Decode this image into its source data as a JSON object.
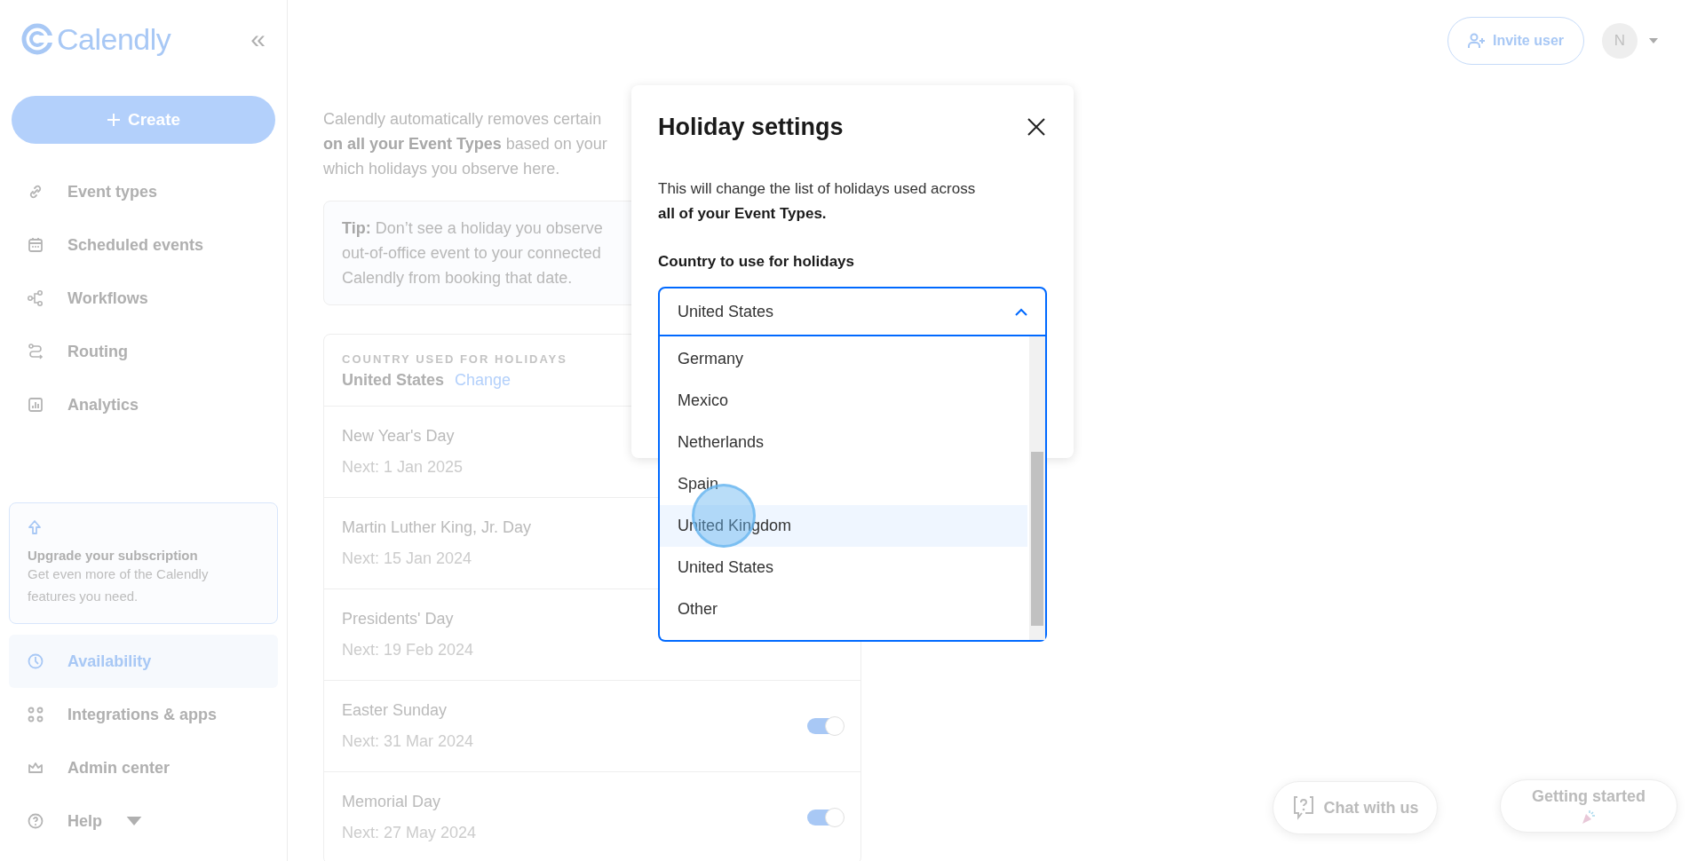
{
  "sidebar": {
    "logo": "Calendly",
    "collapse": "«",
    "create_button": "Create",
    "nav_top": [
      {
        "label": "Event types",
        "selected": false
      },
      {
        "label": "Scheduled events",
        "selected": false
      },
      {
        "label": "Workflows",
        "selected": false
      },
      {
        "label": "Routing",
        "selected": false
      },
      {
        "label": "Analytics",
        "selected": false
      }
    ],
    "upgrade": {
      "title": "Upgrade your subscription",
      "text": "Get even more of the Calendly features you need."
    },
    "nav_bottom": [
      {
        "label": "Availability",
        "selected": true
      },
      {
        "label": "Integrations & apps",
        "selected": false
      },
      {
        "label": "Admin center",
        "selected": false
      },
      {
        "label": "Help",
        "selected": false
      }
    ]
  },
  "header": {
    "invite_button": "Invite user",
    "avatar": "N"
  },
  "main": {
    "intro_lines": [
      "Calendly automatically removes certain",
      "**on all your Event Types** based on your",
      "which holidays you observe here."
    ],
    "tip_lines": [
      "**Tip:** Don’t see a holiday you observe",
      "out-of-office event to your connected",
      "Calendly from booking that date."
    ],
    "country_card": {
      "heading": "COUNTRY USED FOR HOLIDAYS",
      "country": "United States",
      "change_link": "Change"
    },
    "holidays": [
      {
        "name": "New Year's Day",
        "next": "Next: 1 Jan 2025"
      },
      {
        "name": "Martin Luther King, Jr. Day",
        "next": "Next: 15 Jan 2024"
      },
      {
        "name": "Presidents' Day",
        "next": "Next: 19 Feb 2024"
      },
      {
        "name": "Easter Sunday",
        "next": "Next: 31 Mar 2024",
        "on": true
      },
      {
        "name": "Memorial Day",
        "next": "Next: 27 May 2024",
        "on": true
      }
    ]
  },
  "modal": {
    "title": "Holiday settings",
    "description": "This will change the list of holidays used across **all of your Event Types.**",
    "label": "Country to use for holidays",
    "select": {
      "value": "United States",
      "expanded": true
    },
    "options": [
      {
        "label": "Germany",
        "highlighted": false
      },
      {
        "label": "Mexico",
        "highlighted": false
      },
      {
        "label": "Netherlands",
        "highlighted": false
      },
      {
        "label": "Spain",
        "highlighted": false
      },
      {
        "label": "United Kingdom",
        "highlighted": true
      },
      {
        "label": "United States",
        "highlighted": false
      },
      {
        "label": "Other",
        "highlighted": false
      }
    ]
  },
  "chat_button": "Chat with us",
  "getting_started_button": "Getting started"
}
